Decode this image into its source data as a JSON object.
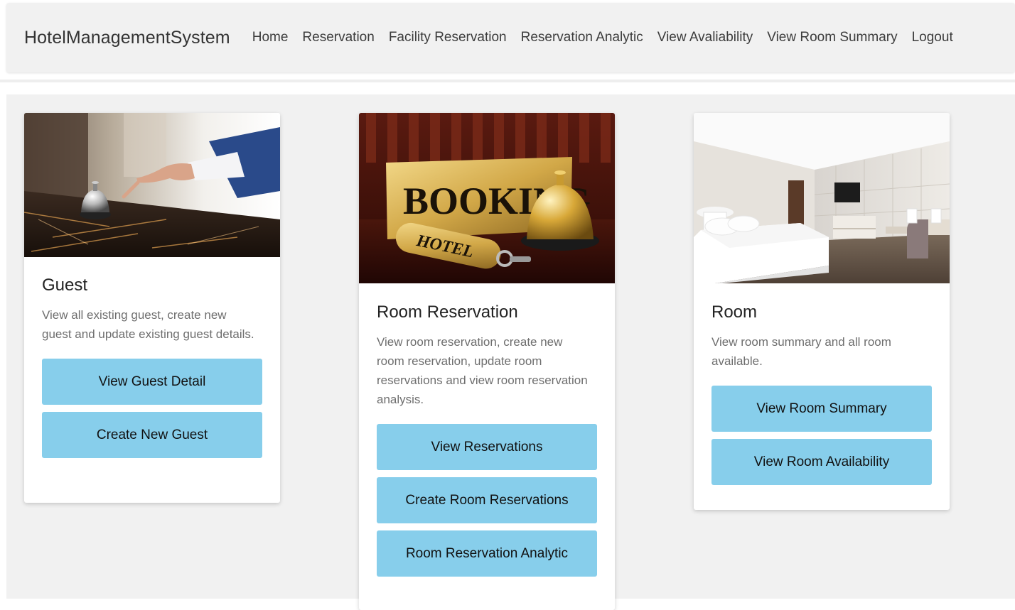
{
  "navbar": {
    "brand": "HotelManagementSystem",
    "links": [
      "Home",
      "Reservation",
      "Facility Reservation",
      "Reservation Analytic",
      "View Avaliability",
      "View Room Summary",
      "Logout"
    ]
  },
  "cards": {
    "guest": {
      "title": "Guest",
      "text": "View all existing guest, create new guest and update existing guest details.",
      "buttons": [
        "View Guest Detail",
        "Create New Guest"
      ],
      "image": "hotel-reception-bell-photo"
    },
    "reservation": {
      "title": "Room Reservation",
      "text": "View room reservation, create new room reservation, update room reservations and view room reservation analysis.",
      "buttons": [
        "View Reservations",
        "Create Room Reservations",
        "Room Reservation Analytic"
      ],
      "image": "booking-sign-bell-photo",
      "image_text": {
        "sign": "BOOKING",
        "keytag": "HOTEL"
      }
    },
    "room": {
      "title": "Room",
      "text": "View room summary and all room available.",
      "buttons": [
        "View Room Summary",
        "View Room Availability"
      ],
      "image": "hotel-room-photo"
    }
  },
  "colors": {
    "button": "#87ceeb",
    "navbar_bg": "#f1f1f1",
    "page_bg": "#f1f1f1"
  }
}
